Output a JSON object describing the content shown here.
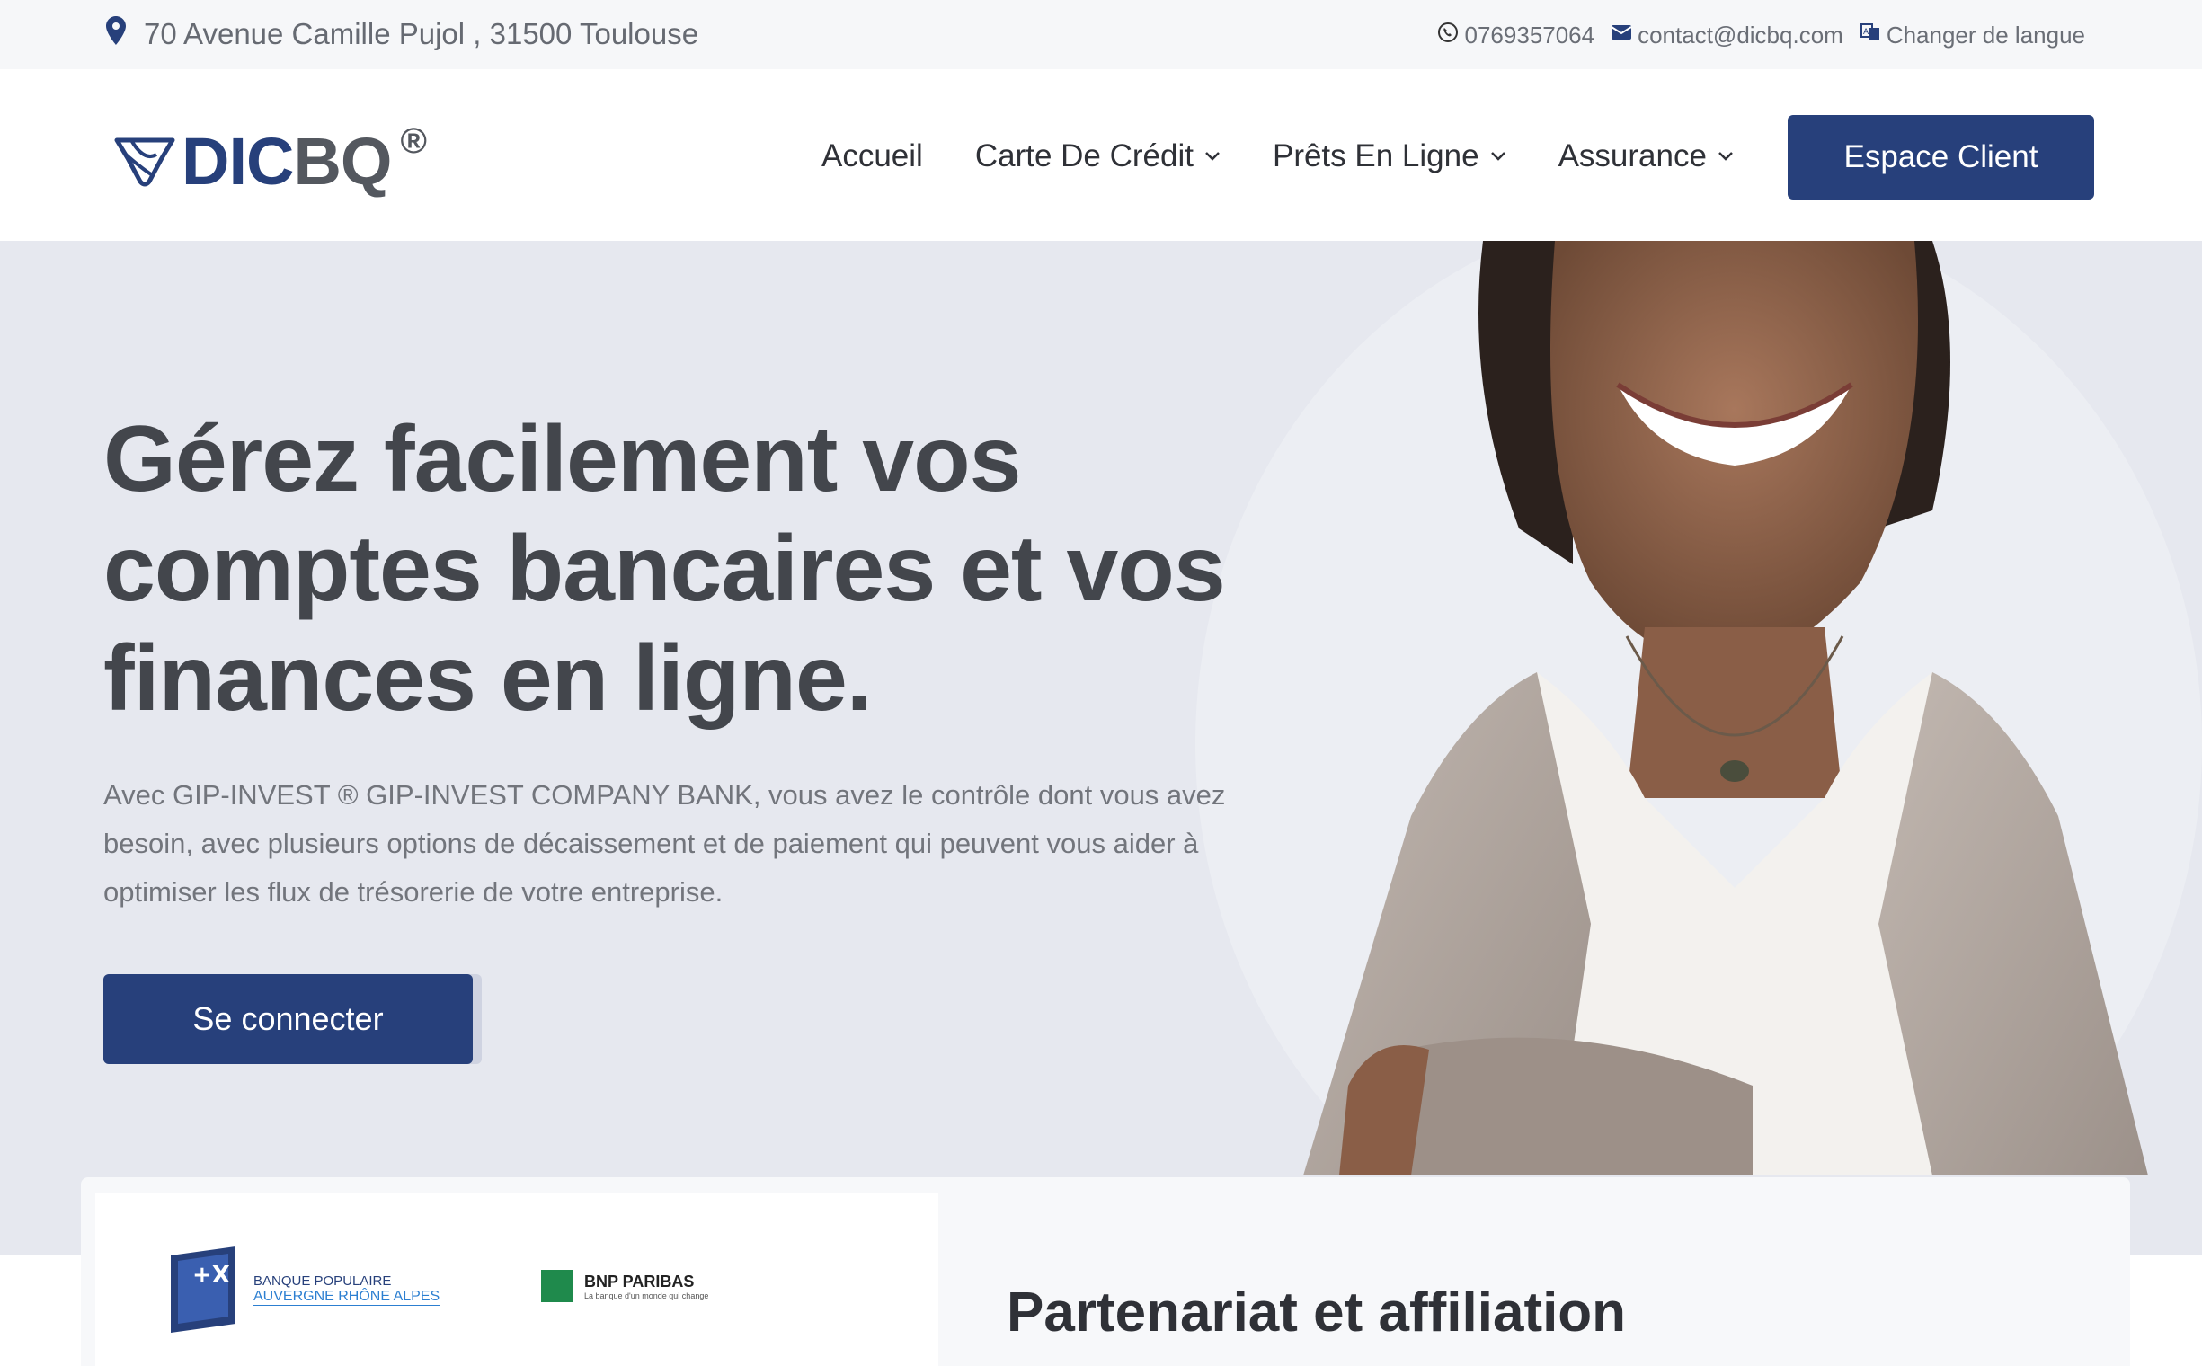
{
  "topbar": {
    "address": "70 Avenue Camille Pujol , 31500 Toulouse",
    "phone": "0769357064",
    "email": "contact@dicbq.com",
    "language": "Changer de langue"
  },
  "brand": {
    "name_part1": "DIC",
    "name_part2": "BQ",
    "registered": "®"
  },
  "nav": {
    "items": [
      {
        "label": "Accueil",
        "dropdown": false
      },
      {
        "label": "Carte De Crédit",
        "dropdown": true
      },
      {
        "label": "Prêts En Ligne",
        "dropdown": true
      },
      {
        "label": "Assurance",
        "dropdown": true
      }
    ],
    "cta": "Espace Client"
  },
  "hero": {
    "title": "Gérez facilement vos comptes bancaires et vos finances en ligne.",
    "description": "Avec GIP-INVEST ® GIP-INVEST COMPANY BANK, vous avez le contrôle dont vous avez besoin, avec plusieurs options de décaissement et de paiement qui peuvent vous aider à optimiser les flux de trésorerie de votre entreprise.",
    "button": "Se connecter"
  },
  "partners": {
    "title": "Partenariat et affiliation",
    "logo1_line1": "BANQUE POPULAIRE",
    "logo1_line2": "AUVERGNE RHÔNE ALPES",
    "logo2_name": "BNP PARIBAS",
    "logo2_tagline": "La banque d'un monde qui change"
  },
  "colors": {
    "brand": "#27407b",
    "hero_bg": "#e6e8ef",
    "text_dark": "#43464c"
  }
}
